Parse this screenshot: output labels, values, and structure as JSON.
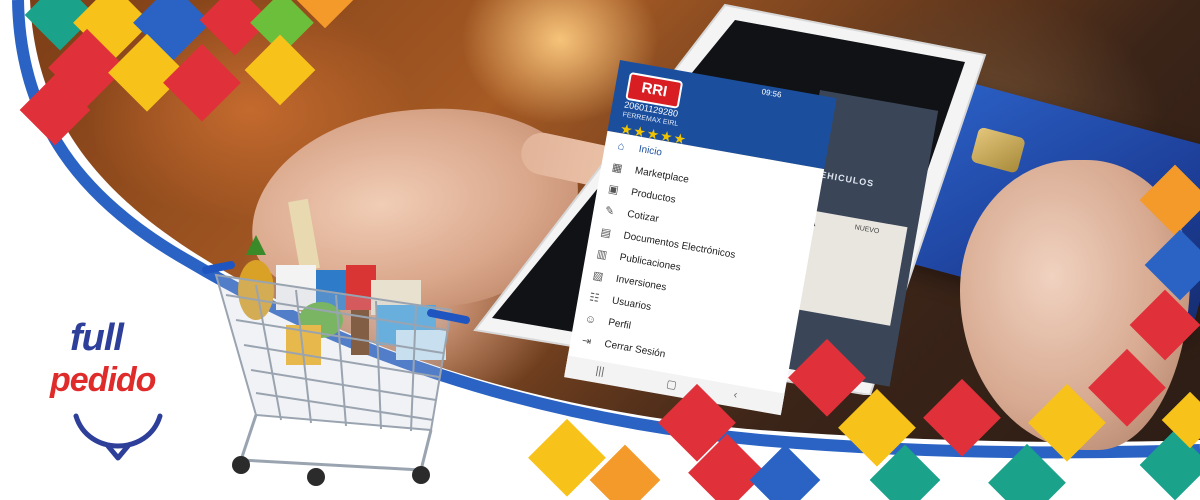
{
  "colors": {
    "red": "#e0313b",
    "yellow": "#f7c21a",
    "orange": "#f39a2a",
    "blue": "#2a63c4",
    "teal": "#1aa38a",
    "green": "#6cbf3a",
    "brand_blue": "#2e3f9a",
    "brand_red": "#e02b2b",
    "drawer_blue": "#1b4f9e"
  },
  "brand": {
    "line1": "full",
    "line2": "pedido",
    "smile_icon": "smile-icon"
  },
  "phone": {
    "status_time": "09:56",
    "header": {
      "logo_text": "RRI",
      "ruc": "20601129280",
      "company": "FERREMAX EIRL",
      "stars": "★★★★★"
    },
    "menu": [
      {
        "label": "Inicio",
        "icon": "home-icon"
      },
      {
        "label": "Marketplace",
        "icon": "marketplace-icon"
      },
      {
        "label": "Productos",
        "icon": "products-icon"
      },
      {
        "label": "Cotizar",
        "icon": "quote-icon"
      },
      {
        "label": "Documentos Electrónicos",
        "icon": "documents-icon"
      },
      {
        "label": "Publicaciones",
        "icon": "publications-icon"
      },
      {
        "label": "Inversiones",
        "icon": "investments-icon"
      },
      {
        "label": "Usuarios",
        "icon": "users-icon"
      },
      {
        "label": "Perfil",
        "icon": "profile-icon"
      },
      {
        "label": "Cerrar Sesión",
        "icon": "logout-icon"
      }
    ],
    "background_text": {
      "vehiculos": "VEHICULOS",
      "na": "NA",
      "nuevo": "NUEVO"
    },
    "navbar": {
      "back_icon": "back-icon",
      "home_icon": "home-nav-icon",
      "recent_icon": "recent-icon"
    }
  }
}
